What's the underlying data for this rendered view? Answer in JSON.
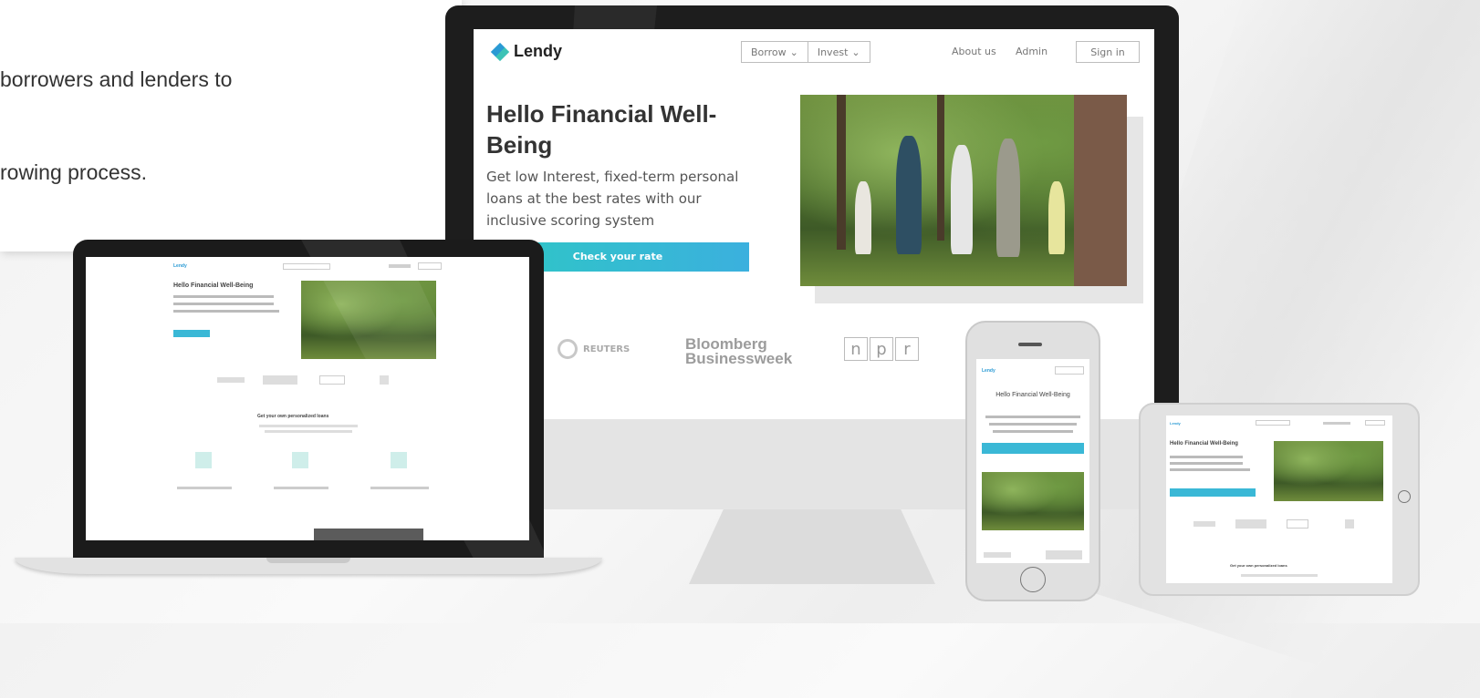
{
  "intro": {
    "line1": "borrowers and lenders to",
    "line2": "rowing process."
  },
  "site": {
    "brand": "Lendy",
    "nav": {
      "borrow": "Borrow",
      "invest": "Invest",
      "about": "About us",
      "admin": "Admin",
      "signin": "Sign in"
    },
    "hero": {
      "title": "Hello Financial Well-Being",
      "subtitle": "Get low Interest, fixed-term personal loans at the best rates with our inclusive scoring system",
      "cta": "Check your rate"
    },
    "press": {
      "reuters": "REUTERS",
      "bloomberg_line1": "Bloomberg",
      "bloomberg_line2": "Businessweek",
      "npr": [
        "n",
        "p",
        "r"
      ]
    },
    "section_title": "Get your own personalized loans"
  },
  "colors": {
    "accent_start": "#2ec7c5",
    "accent_end": "#3bb0de",
    "device_dark": "#1d1d1d",
    "device_light": "#e2e2e2"
  }
}
